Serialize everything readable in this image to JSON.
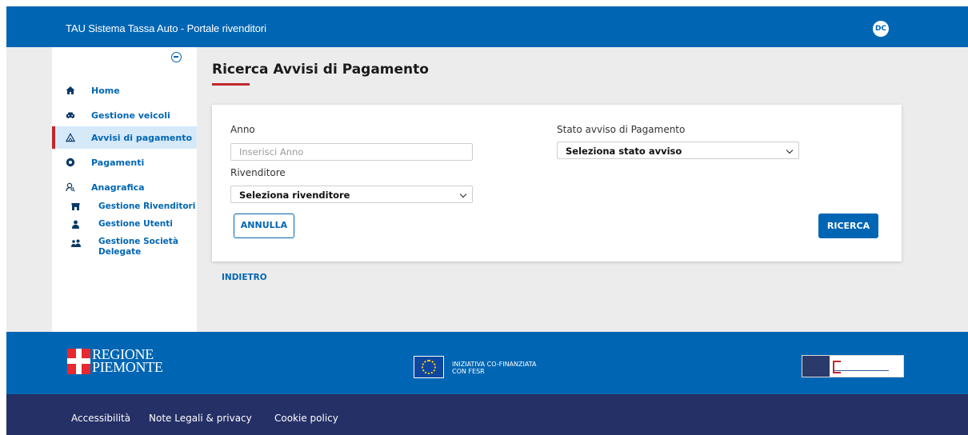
{
  "header": {
    "title": "TAU Sistema Tassa Auto - Portale rivenditori",
    "avatar_initials": "DC"
  },
  "sidebar": {
    "items": [
      {
        "label": "Home",
        "icon": "home-icon"
      },
      {
        "label": "Gestione veicoli",
        "icon": "car-icon"
      },
      {
        "label": "Avvisi di pagamento",
        "icon": "warning-triangle-icon",
        "active": true
      },
      {
        "label": "Pagamenti",
        "icon": "euro-coin-icon"
      },
      {
        "label": "Anagrafica",
        "icon": "person-search-icon"
      }
    ],
    "subitems": [
      {
        "label": "Gestione Rivenditori",
        "icon": "store-icon"
      },
      {
        "label": "Gestione Utenti",
        "icon": "user-icon"
      },
      {
        "label_line1": "Gestione Società",
        "label_line2": "Delegate",
        "icon": "group-icon"
      }
    ]
  },
  "main": {
    "title": "Ricerca Avvisi di Pagamento",
    "form": {
      "anno_label": "Anno",
      "anno_placeholder": "Inserisci Anno",
      "anno_value": "",
      "rivenditore_label": "Rivenditore",
      "rivenditore_value": "Seleziona rivenditore",
      "stato_label": "Stato avviso di Pagamento",
      "stato_value": "Seleziona stato avviso",
      "cancel_label": "ANNULLA",
      "search_label": "RICERCA"
    },
    "back_label": "INDIETRO"
  },
  "footer": {
    "logo_text_line1": "REGIONE",
    "logo_text_line2": "PIEMONTE",
    "eu_text_line1": "INIZIATIVA CO-FINANZIATA",
    "eu_text_line2": "CON FESR",
    "links": [
      "Accessibilità",
      "Note Legali & privacy",
      "Cookie policy"
    ]
  },
  "colors": {
    "primary": "#0066b3",
    "accent_red": "#c1272d",
    "footer_dark": "#253066",
    "active_bg": "#d6e9f9"
  }
}
